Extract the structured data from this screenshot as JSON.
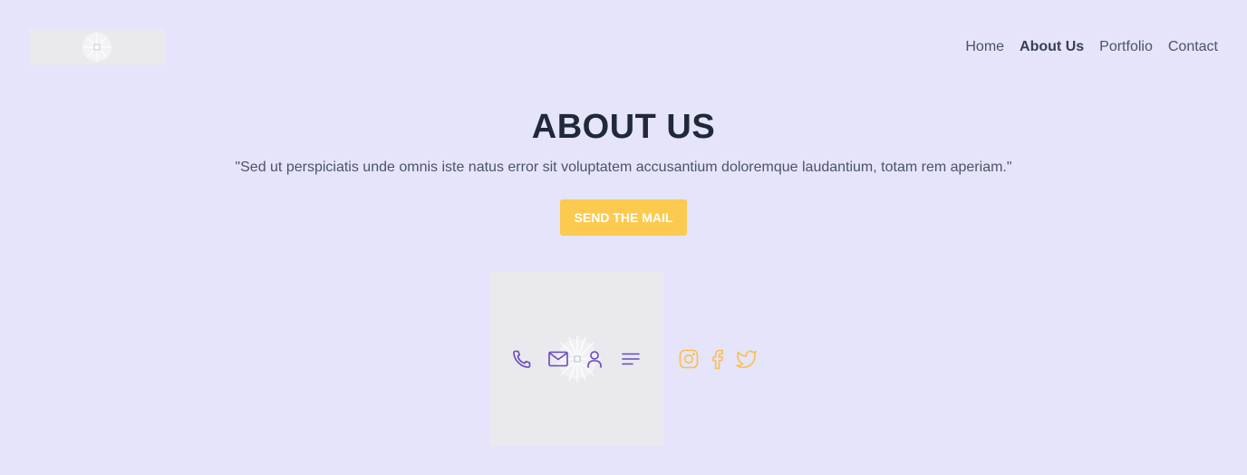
{
  "header": {
    "logo_icon": "image-placeholder-icon",
    "nav": [
      {
        "label": "Home",
        "active": false
      },
      {
        "label": "About Us",
        "active": true
      },
      {
        "label": "Portfolio",
        "active": false
      },
      {
        "label": "Contact",
        "active": false
      }
    ]
  },
  "hero": {
    "title": "ABOUT US",
    "quote": "\"Sed ut perspiciatis unde omnis iste natus error sit voluptatem accusantium doloremque laudantium, totam rem aperiam.\"",
    "cta_label": "SEND THE MAIL"
  },
  "contact_icons": [
    "phone-icon",
    "mail-icon",
    "user-icon",
    "menu-icon"
  ],
  "social_icons": [
    "instagram-icon",
    "facebook-icon",
    "twitter-icon"
  ],
  "colors": {
    "background": "#e5e4fb",
    "accent_yellow": "#fcca4f",
    "icon_purple": "#6b46c1",
    "social_yellow": "#fbbf4a",
    "heading": "#1f2937",
    "text": "#4b5563",
    "placeholder": "#e9e9ee"
  }
}
